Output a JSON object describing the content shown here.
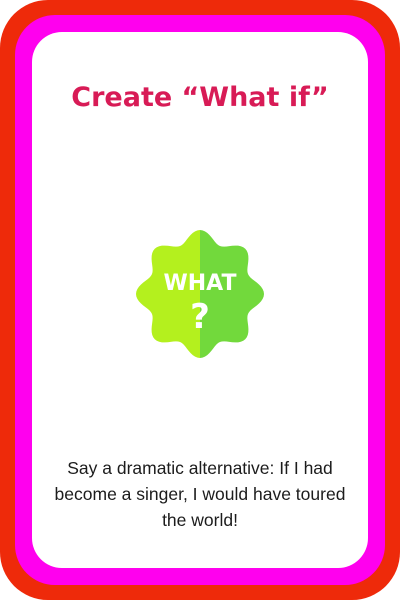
{
  "card": {
    "title": "Create “What if”",
    "badge": {
      "label": "WHAT",
      "symbol": "?",
      "icon": "what-question-badge-icon",
      "left_color": "#b4f01e",
      "right_color": "#72d93c"
    },
    "prompt": "Say a dramatic alternative: If I had become a singer, I would have toured the world!"
  },
  "colors": {
    "outer_border": "#ee2a0a",
    "inner_border": "#ff00ee",
    "title": "#d81b56",
    "background": "#ffffff"
  }
}
